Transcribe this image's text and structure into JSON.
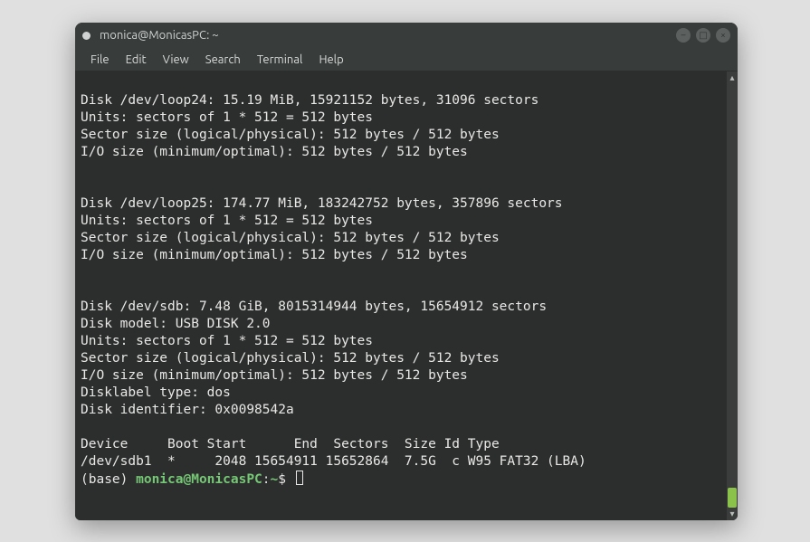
{
  "window": {
    "title": "monica@MonicasPC: ~"
  },
  "menu": {
    "file": "File",
    "edit": "Edit",
    "view": "View",
    "search": "Search",
    "terminal": "Terminal",
    "help": "Help"
  },
  "output": {
    "loop24_header": "Disk /dev/loop24: 15.19 MiB, 15921152 bytes, 31096 sectors",
    "loop24_units": "Units: sectors of 1 * 512 = 512 bytes",
    "loop24_sector": "Sector size (logical/physical): 512 bytes / 512 bytes",
    "loop24_io": "I/O size (minimum/optimal): 512 bytes / 512 bytes",
    "loop25_header": "Disk /dev/loop25: 174.77 MiB, 183242752 bytes, 357896 sectors",
    "loop25_units": "Units: sectors of 1 * 512 = 512 bytes",
    "loop25_sector": "Sector size (logical/physical): 512 bytes / 512 bytes",
    "loop25_io": "I/O size (minimum/optimal): 512 bytes / 512 bytes",
    "sdb_header": "Disk /dev/sdb: 7.48 GiB, 8015314944 bytes, 15654912 sectors",
    "sdb_model": "Disk model: USB DISK 2.0",
    "sdb_units": "Units: sectors of 1 * 512 = 512 bytes",
    "sdb_sector": "Sector size (logical/physical): 512 bytes / 512 bytes",
    "sdb_io": "I/O size (minimum/optimal): 512 bytes / 512 bytes",
    "sdb_labeltype": "Disklabel type: dos",
    "sdb_identifier": "Disk identifier: 0x0098542a",
    "table_header": "Device     Boot Start      End  Sectors  Size Id Type",
    "table_row1": "/dev/sdb1  *     2048 15654911 15652864  7.5G  c W95 FAT32 (LBA)"
  },
  "prompt": {
    "base": "(base) ",
    "user": "monica@MonicasPC",
    "sep": ":",
    "path": "~",
    "symbol": "$ "
  }
}
